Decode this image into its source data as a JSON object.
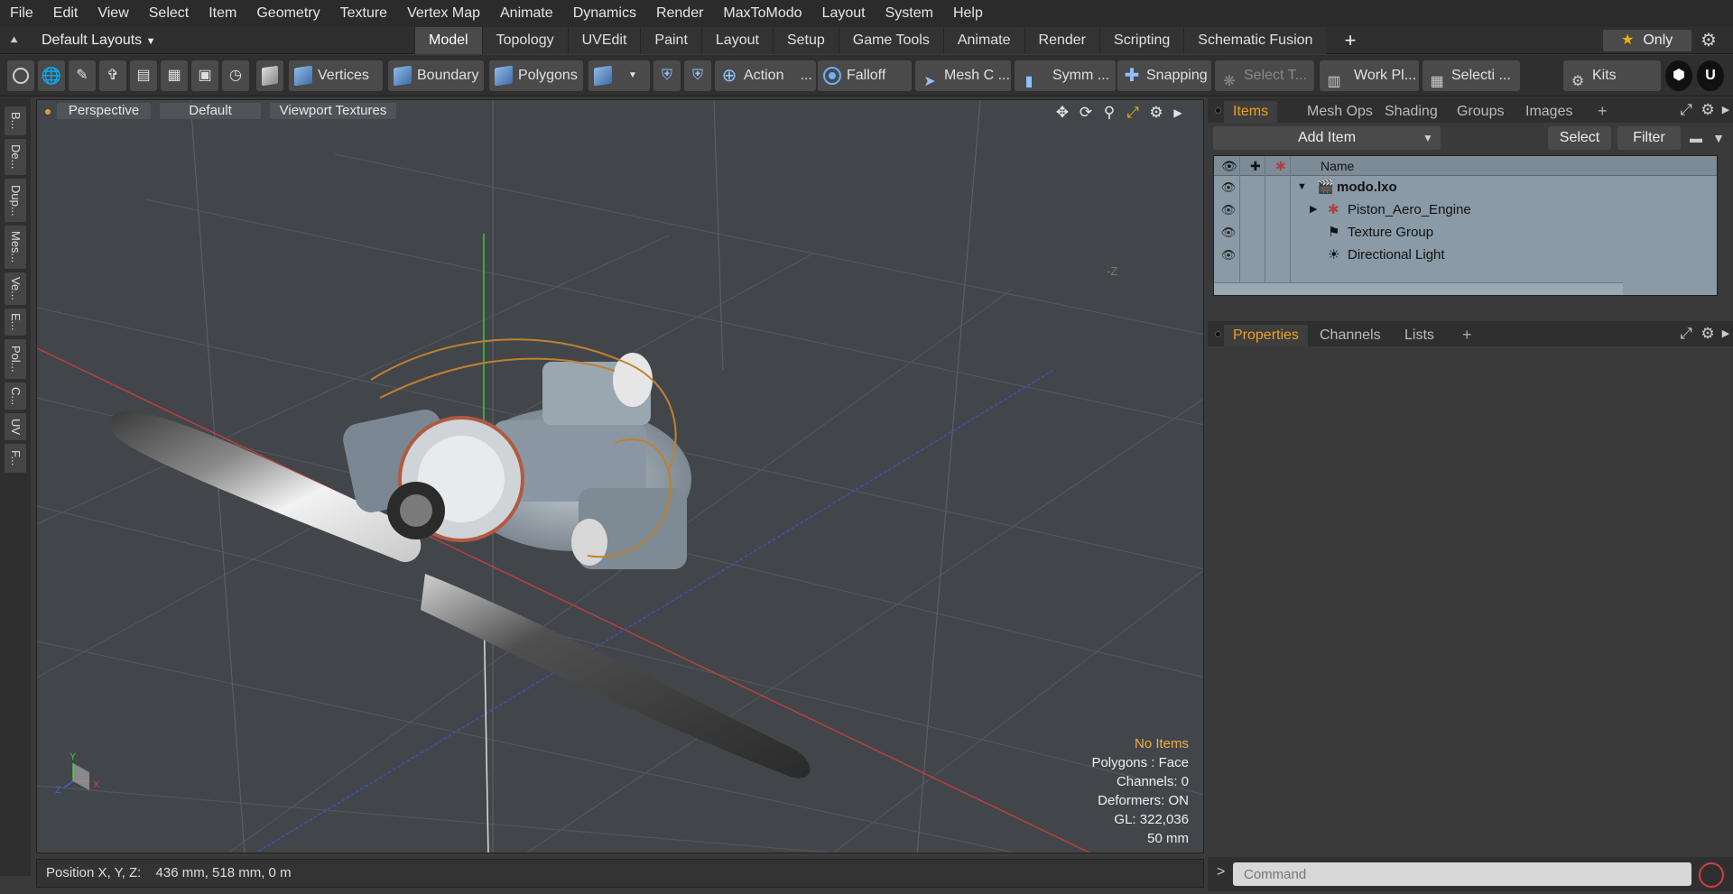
{
  "menu": [
    "File",
    "Edit",
    "View",
    "Select",
    "Item",
    "Geometry",
    "Texture",
    "Vertex Map",
    "Animate",
    "Dynamics",
    "Render",
    "MaxToModo",
    "Layout",
    "System",
    "Help"
  ],
  "layout": {
    "dropdown_label": "Default Layouts",
    "tabs": [
      "Model",
      "Topology",
      "UVEdit",
      "Paint",
      "Layout",
      "Setup",
      "Game Tools",
      "Animate",
      "Render",
      "Scripting",
      "Schematic Fusion"
    ],
    "active_tab": "Model",
    "only_label": "Only"
  },
  "toolbar": {
    "vertices": "Vertices",
    "boundary": "Boundary",
    "polygons": "Polygons",
    "action": "Action",
    "action_more": "...",
    "falloff": "Falloff",
    "mesh": "Mesh C ...",
    "symm": "Symm ...",
    "snapping": "Snapping",
    "select_t": "Select T...",
    "work_plane": "Work Pl...",
    "selection": "Selecti ...",
    "kits": "Kits"
  },
  "left_strip": [
    "B...",
    "De...",
    "Dup...",
    "Mes...",
    "Ve...",
    "E...",
    "Pol...",
    "C...",
    "UV",
    "F..."
  ],
  "viewport": {
    "view_mode": "Perspective",
    "shading": "Default",
    "textures": "Viewport Textures",
    "axis_label_neg_z": "-Z",
    "info": {
      "items": "No Items",
      "polygons": "Polygons : Face",
      "channels": "Channels: 0",
      "deformers": "Deformers: ON",
      "gl": "GL: 322,036",
      "scale": "50 mm"
    },
    "gizmo": {
      "x": "X",
      "y": "Y",
      "z": "Z"
    }
  },
  "status": {
    "position_label": "Position X, Y, Z:",
    "position_value": "436 mm, 518 mm, 0 m"
  },
  "items_panel": {
    "tabs": [
      "Items",
      "Mesh Ops",
      "Shading",
      "Groups",
      "Images"
    ],
    "active_tab": "Items",
    "add_item": "Add Item",
    "select": "Select",
    "filter": "Filter",
    "name_header": "Name",
    "tree": [
      {
        "label": "modo.lxo",
        "icon": "scene-icon",
        "expanded": true
      },
      {
        "label": "Piston_Aero_Engine",
        "icon": "locator-icon",
        "expanded": false
      },
      {
        "label": "Texture Group",
        "icon": "folder-icon"
      },
      {
        "label": "Directional Light",
        "icon": "light-icon"
      }
    ]
  },
  "properties_panel": {
    "tabs": [
      "Properties",
      "Channels",
      "Lists"
    ],
    "active_tab": "Properties"
  },
  "command": {
    "prompt": ">",
    "placeholder": "Command"
  },
  "colors": {
    "accent": "#f0a020",
    "viewport_bg": "#42464a",
    "tree_bg": "#8a9aa6"
  }
}
